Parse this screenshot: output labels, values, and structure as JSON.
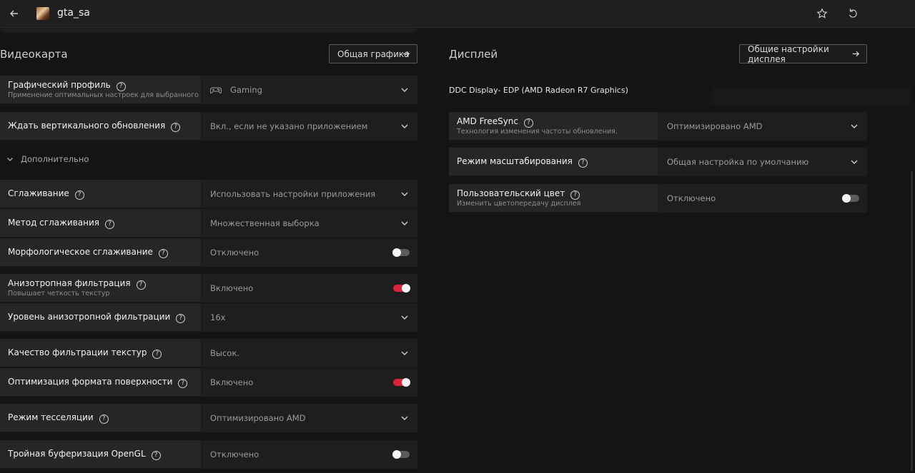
{
  "topbar": {
    "title": "gta_sa",
    "back_icon": "arrow-left-icon",
    "game_icon": "game-thumbnail-icon",
    "star_icon": "star-icon",
    "reset_icon": "reset-icon"
  },
  "left": {
    "section_title": "Видеокарта",
    "general_button": "Общая графика",
    "advanced_label": "Дополнительно",
    "rows": [
      {
        "label": "Графический профиль",
        "sub": "Применение оптимальных настроек для выбранного типа...",
        "value": "Gaming",
        "control": "dropdown",
        "icon": "gamepad-icon"
      },
      {
        "label": "Ждать вертикального обновления",
        "value": "Вкл., если не указано приложением",
        "control": "dropdown"
      },
      {
        "label": "Сглаживание",
        "value": "Использовать настройки приложения",
        "control": "dropdown"
      },
      {
        "label": "Метод сглаживания",
        "value": "Множественная выборка",
        "control": "dropdown"
      },
      {
        "label": "Морфологическое сглаживание",
        "value": "Отключено",
        "control": "toggle",
        "on": false
      },
      {
        "label": "Анизотропная фильтрация",
        "sub": "Повышает четкость текстур",
        "value": "Включено",
        "control": "toggle",
        "on": true
      },
      {
        "label": "Уровень анизотропной фильтрации",
        "value": "16x",
        "control": "dropdown"
      },
      {
        "label": "Качество фильтрации текстур",
        "value": "Высок.",
        "control": "dropdown"
      },
      {
        "label": "Оптимизация формата поверхности",
        "value": "Включено",
        "control": "toggle",
        "on": true
      },
      {
        "label": "Режим тесселяции",
        "value": "Оптимизировано AMD",
        "control": "dropdown"
      },
      {
        "label": "Тройная буферизация OpenGL",
        "value": "Отключено",
        "control": "toggle",
        "on": false
      }
    ]
  },
  "right": {
    "section_title": "Дисплей",
    "general_button": "Общие настройки дисплея",
    "display_name": "DDC Display- EDP (AMD Radeon R7 Graphics)",
    "rows": [
      {
        "label": "AMD FreeSync",
        "sub": "Технология изменения частоты обновления.",
        "value": "Оптимизировано AMD",
        "control": "dropdown"
      },
      {
        "label": "Режим масштабирования",
        "value": "Общая настройка по умолчанию",
        "control": "dropdown"
      },
      {
        "label": "Пользовательский цвет",
        "sub": "Изменить цветопередачу дисплея",
        "value": "Отключено",
        "control": "toggle",
        "on": false
      }
    ]
  },
  "colors": {
    "accent": "#d9263b",
    "panel": "#262626",
    "value_bg": "#1e1e1e",
    "background": "#141414"
  }
}
